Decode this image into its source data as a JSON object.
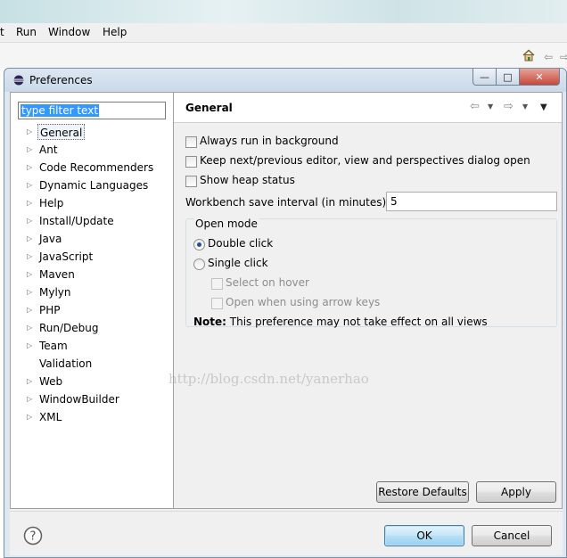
{
  "background_app": {
    "menu": [
      "t",
      "Run",
      "Window",
      "Help"
    ],
    "nav_icons": [
      "back-arrow-icon",
      "forward-arrow-icon"
    ]
  },
  "dialog": {
    "title": "Preferences",
    "window_buttons": {
      "minimize": "—",
      "maximize": "□",
      "close": "✕"
    }
  },
  "filter": {
    "text": "type filter text"
  },
  "tree": {
    "items": [
      {
        "label": "General",
        "expandable": true,
        "selected": true
      },
      {
        "label": "Ant",
        "expandable": true
      },
      {
        "label": "Code Recommenders",
        "expandable": true
      },
      {
        "label": "Dynamic Languages",
        "expandable": true
      },
      {
        "label": "Help",
        "expandable": true
      },
      {
        "label": "Install/Update",
        "expandable": true
      },
      {
        "label": "Java",
        "expandable": true
      },
      {
        "label": "JavaScript",
        "expandable": true
      },
      {
        "label": "Maven",
        "expandable": true
      },
      {
        "label": "Mylyn",
        "expandable": true
      },
      {
        "label": "PHP",
        "expandable": true
      },
      {
        "label": "Run/Debug",
        "expandable": true
      },
      {
        "label": "Team",
        "expandable": true
      },
      {
        "label": "Validation",
        "expandable": false
      },
      {
        "label": "Web",
        "expandable": true
      },
      {
        "label": "WindowBuilder",
        "expandable": true
      },
      {
        "label": "XML",
        "expandable": true
      }
    ]
  },
  "page": {
    "title": "General",
    "checkboxes": {
      "always_run_bg": {
        "label": "Always run in background",
        "checked": false
      },
      "keep_next_prev": {
        "label": "Keep next/previous editor, view and perspectives dialog open",
        "checked": false
      },
      "show_heap": {
        "label": "Show heap status",
        "checked": false
      }
    },
    "save_interval": {
      "label": "Workbench save interval (in minutes):",
      "value": "5"
    },
    "open_mode": {
      "title": "Open mode",
      "double_click": {
        "label": "Double click",
        "selected": true
      },
      "single_click": {
        "label": "Single click",
        "selected": false
      },
      "select_on_hover": {
        "label": "Select on hover",
        "checked": false,
        "enabled": false
      },
      "open_arrow_keys": {
        "label": "Open when using arrow keys",
        "checked": false,
        "enabled": false
      },
      "note_bold": "Note:",
      "note_text": " This preference may not take effect on all views"
    },
    "restore_defaults": "Restore Defaults",
    "apply": "Apply"
  },
  "watermark": "http://blog.csdn.net/yanerhao",
  "footer": {
    "ok": "OK",
    "cancel": "Cancel"
  },
  "colors": {
    "selection": "#3399ff",
    "default_button": "#98d1ef",
    "close_button": "#c8483a"
  }
}
